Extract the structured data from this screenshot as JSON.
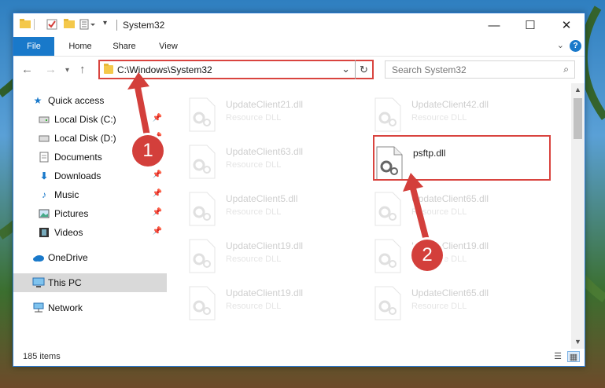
{
  "window": {
    "title": "System32",
    "controls": {
      "minimize": "—",
      "maximize": "☐",
      "close": "✕"
    }
  },
  "ribbon": {
    "tabs": [
      "File",
      "Home",
      "Share",
      "View"
    ],
    "help": "?"
  },
  "address_bar": {
    "path": "C:\\Windows\\System32",
    "search_placeholder": "Search System32"
  },
  "sidebar": {
    "items": [
      {
        "label": "Quick access",
        "icon": "star-icon",
        "pinned": false
      },
      {
        "label": "Local Disk (C:)",
        "icon": "drive-icon",
        "pinned": true
      },
      {
        "label": "Local Disk (D:)",
        "icon": "drive-icon",
        "pinned": true
      },
      {
        "label": "Documents",
        "icon": "documents-icon",
        "pinned": true
      },
      {
        "label": "Downloads",
        "icon": "download-icon",
        "pinned": true
      },
      {
        "label": "Music",
        "icon": "music-icon",
        "pinned": true
      },
      {
        "label": "Pictures",
        "icon": "pictures-icon",
        "pinned": true
      },
      {
        "label": "Videos",
        "icon": "videos-icon",
        "pinned": true
      },
      {
        "label": "OneDrive",
        "icon": "cloud-icon",
        "pinned": false
      },
      {
        "label": "This PC",
        "icon": "computer-icon",
        "pinned": false,
        "selected": true
      },
      {
        "label": "Network",
        "icon": "network-icon",
        "pinned": false
      }
    ]
  },
  "files": [
    {
      "name": "UpdateClient21.dll",
      "type": "Resource DLL",
      "faded": true
    },
    {
      "name": "UpdateClient42.dll",
      "type": "Resource DLL",
      "faded": true
    },
    {
      "name": "UpdateClient63.dll",
      "type": "Resource DLL",
      "faded": true
    },
    {
      "name": "psftp.dll",
      "type": "",
      "faded": false,
      "highlighted": true
    },
    {
      "name": "UpdateClient5.dll",
      "type": "Resource DLL",
      "faded": true
    },
    {
      "name": "UpdateClient65.dll",
      "type": "Resource DLL",
      "faded": true
    },
    {
      "name": "UpdateClient19.dll",
      "type": "Resource DLL",
      "faded": true
    },
    {
      "name": "UpdateClient19.dll",
      "type": "Resource DLL",
      "faded": true
    },
    {
      "name": "UpdateClient19.dll",
      "type": "Resource DLL",
      "faded": true
    },
    {
      "name": "UpdateClient65.dll",
      "type": "Resource DLL",
      "faded": true
    }
  ],
  "status": {
    "item_count": "185 items"
  },
  "annotations": {
    "step1": "1",
    "step2": "2",
    "color": "#d33f3b"
  }
}
